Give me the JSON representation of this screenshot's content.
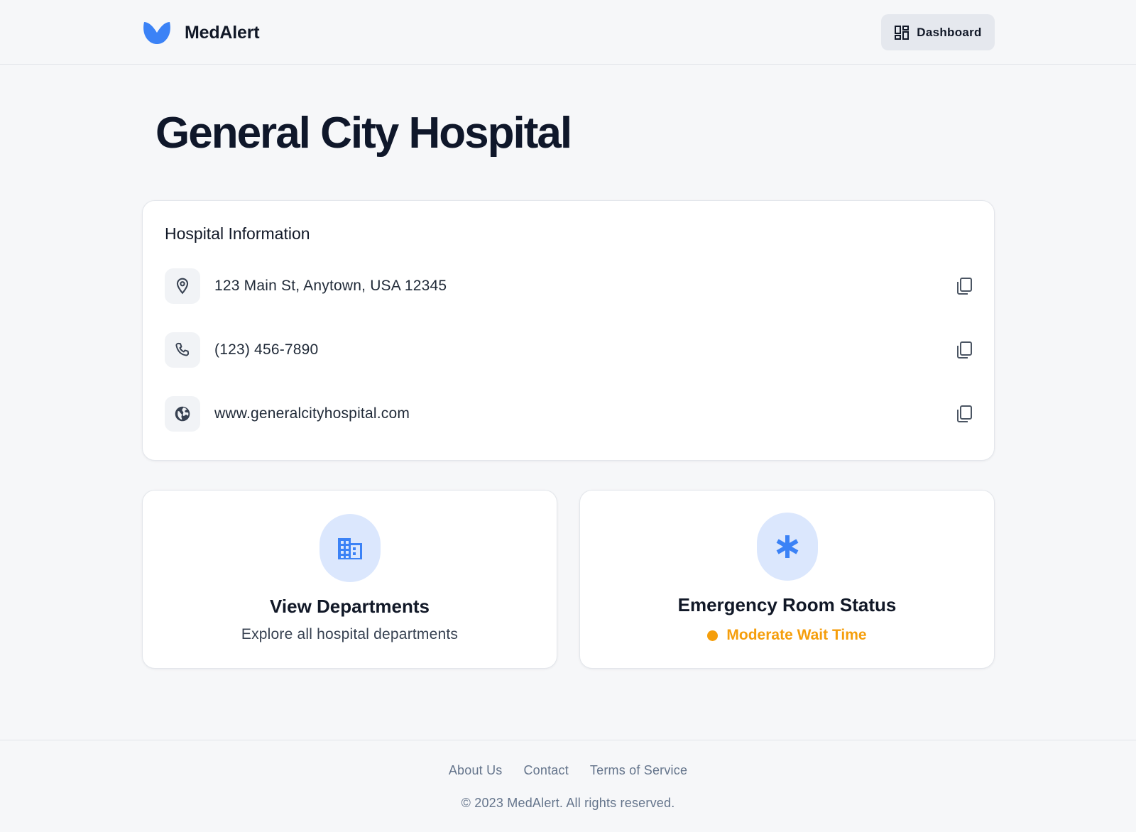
{
  "header": {
    "brand_name": "MedAlert",
    "dashboard_label": "Dashboard"
  },
  "page": {
    "title": "General City Hospital"
  },
  "info": {
    "title": "Hospital Information",
    "rows": [
      {
        "icon": "location-pin-icon",
        "text": "123 Main St, Anytown, USA 12345"
      },
      {
        "icon": "phone-icon",
        "text": "(123) 456-7890"
      },
      {
        "icon": "globe-icon",
        "text": "www.generalcityhospital.com"
      }
    ]
  },
  "departments": {
    "icon": "building-icon",
    "title": "View Departments",
    "subtitle": "Explore all hospital departments"
  },
  "emergency": {
    "icon": "asterisk-icon",
    "title": "Emergency Room Status",
    "status": "Moderate Wait Time",
    "status_color": "#f59e0b"
  },
  "footer": {
    "links": [
      "About Us",
      "Contact",
      "Terms of Service"
    ],
    "copyright": "© 2023 MedAlert. All rights reserved."
  },
  "colors": {
    "accent": "#3b82f6",
    "accent_light": "#dbe7fd",
    "background": "#f6f7f9",
    "text_dark": "#0f172a"
  }
}
